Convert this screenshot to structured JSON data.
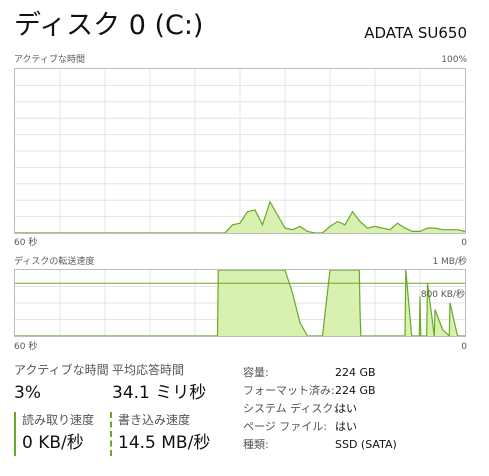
{
  "window": {
    "title": "ディスク 0 (C:)",
    "model": "ADATA SU650"
  },
  "colors": {
    "fill": "#d8f0b0",
    "line": "#6aa928",
    "grid": "#e4e4e4",
    "border": "#bcbcbc"
  },
  "active_graph": {
    "label": "アクティブな時間",
    "max_label": "100%",
    "time_left": "60 秒",
    "time_right": "0"
  },
  "transfer_graph": {
    "label": "ディスクの転送速度",
    "max_label": "1 MB/秒",
    "marker_label": "800 KB/秒",
    "time_left": "60 秒",
    "time_right": "0"
  },
  "stats": {
    "active_time_label": "アクティブな時間",
    "active_time_value": "3%",
    "avg_response_label": "平均応答時間",
    "avg_response_value": "34.1 ミリ秒",
    "read_speed_label": "読み取り速度",
    "read_speed_value": "0 KB/秒",
    "write_speed_label": "書き込み速度",
    "write_speed_value": "14.5 MB/秒"
  },
  "properties": [
    {
      "key": "容量:",
      "value": "224 GB"
    },
    {
      "key": "フォーマット済み:",
      "value": "224 GB"
    },
    {
      "key": "システム ディスク:",
      "value": "はい"
    },
    {
      "key": "ページ ファイル:",
      "value": "はい"
    },
    {
      "key": "種類:",
      "value": "SSD (SATA)"
    }
  ],
  "chart_data": [
    {
      "type": "area",
      "title": "アクティブな時間",
      "x": [
        60,
        50,
        40,
        33,
        32,
        31,
        30,
        29,
        28,
        27,
        26,
        25,
        24,
        23,
        22,
        21,
        20,
        19,
        18,
        17,
        16,
        15,
        14,
        13,
        12,
        11,
        10,
        9,
        8,
        7,
        6,
        5,
        4,
        3,
        2,
        1,
        0
      ],
      "y": [
        0,
        0,
        0,
        0,
        0,
        5,
        6,
        13,
        14,
        5,
        19,
        11,
        3,
        2,
        4,
        1,
        0,
        0,
        4,
        7,
        5,
        13,
        7,
        3,
        4,
        3,
        2,
        6,
        3,
        1,
        1,
        3,
        3,
        2,
        2,
        2,
        1
      ],
      "xlabel": "",
      "ylabel": "",
      "ylim": [
        0,
        100
      ]
    },
    {
      "type": "area",
      "title": "ディスクの転送速度",
      "x": [
        60,
        33,
        32.9,
        32.1,
        32,
        31,
        30,
        29,
        28,
        27,
        26,
        25,
        24,
        23,
        22,
        21,
        20,
        19,
        18,
        17,
        16,
        15,
        14.1,
        14,
        13.9,
        13,
        12.9,
        8,
        7.9,
        7.1,
        7,
        6.1,
        6,
        5.9,
        5.1,
        5,
        4.1,
        4,
        3,
        2.1,
        2,
        1.1,
        1,
        0
      ],
      "y": [
        0,
        0,
        1,
        1,
        1,
        1,
        1,
        1,
        1,
        1,
        1,
        1,
        1,
        0.65,
        0.2,
        0,
        0,
        0,
        1,
        1,
        1,
        1,
        1,
        0.4,
        0,
        0,
        0,
        0,
        1,
        0,
        0,
        0,
        0.6,
        0,
        0,
        0.8,
        0,
        0.4,
        0.1,
        0,
        0.5,
        0.05,
        0,
        0
      ],
      "xlabel": "",
      "ylabel": "",
      "ylim": [
        0,
        1
      ]
    }
  ]
}
